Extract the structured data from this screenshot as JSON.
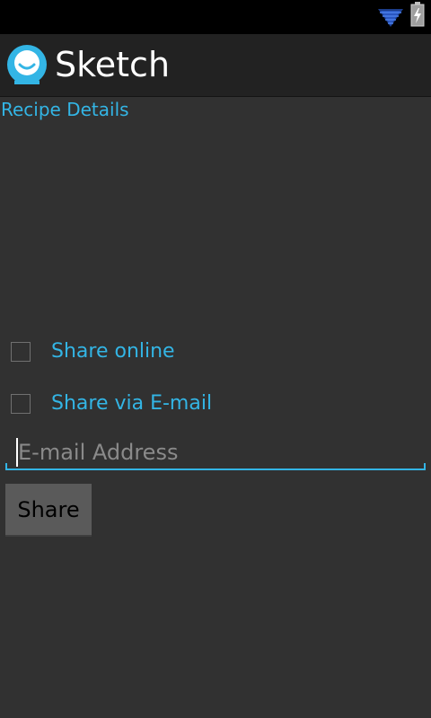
{
  "status_bar": {
    "wifi_icon": "wifi-signal-icon",
    "battery_icon": "battery-charging-icon"
  },
  "action_bar": {
    "logo_icon": "app-logo-icon",
    "title": "Sketch"
  },
  "content": {
    "section_title": "Recipe Details",
    "checkboxes": [
      {
        "label": "Share online",
        "checked": false
      },
      {
        "label": "Share via E-mail",
        "checked": false
      }
    ],
    "email": {
      "value": "",
      "placeholder": "E-mail Address"
    },
    "share_button_label": "Share"
  },
  "colors": {
    "accent": "#33b5e5",
    "background": "#313131",
    "action_bar": "#222222",
    "status_bar": "#000000"
  }
}
